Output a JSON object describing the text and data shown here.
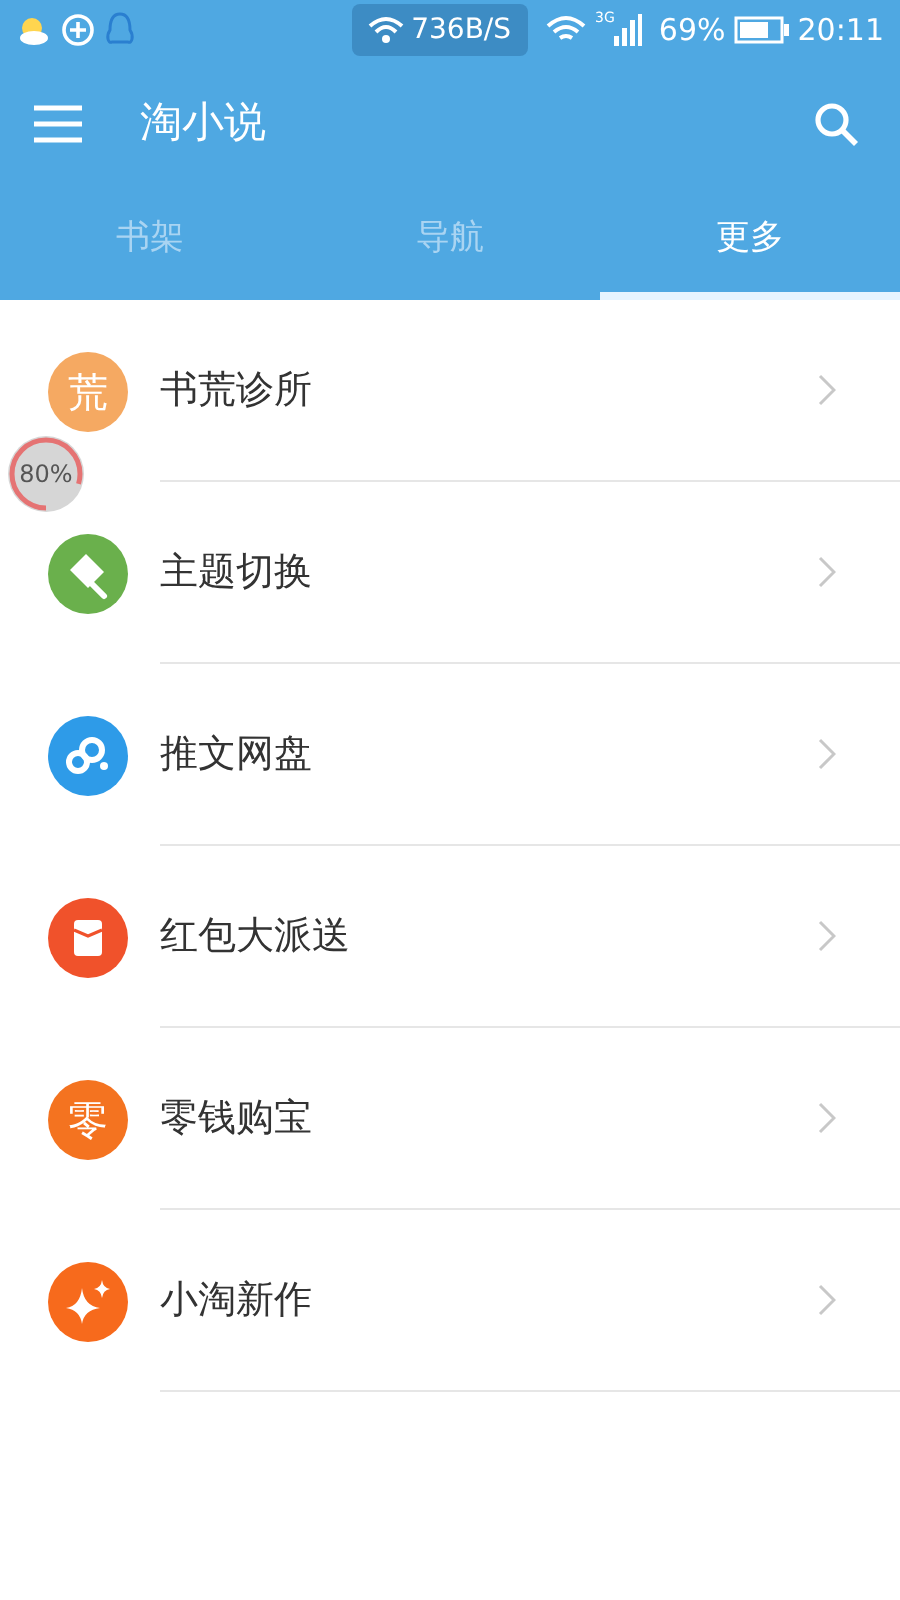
{
  "status_bar": {
    "speed": "736B/S",
    "network": "3G",
    "battery": "69%",
    "time": "20:11"
  },
  "toolbar": {
    "title": "淘小说"
  },
  "tabs": [
    {
      "label": "书架",
      "selected": false
    },
    {
      "label": "导航",
      "selected": false
    },
    {
      "label": "更多",
      "selected": true
    }
  ],
  "menu": [
    {
      "label": "书荒诊所",
      "kind": "glyph",
      "glyph": "荒",
      "color": "#f5a962"
    },
    {
      "label": "主题切换",
      "kind": "brush",
      "color": "#6ab04c"
    },
    {
      "label": "推文网盘",
      "kind": "cloud",
      "color": "#2e9be8"
    },
    {
      "label": "红包大派送",
      "kind": "envelope",
      "color": "#f0522b"
    },
    {
      "label": "零钱购宝",
      "kind": "glyph",
      "glyph": "零",
      "color": "#f47320"
    },
    {
      "label": "小淘新作",
      "kind": "sparkle",
      "color": "#f76a1c"
    }
  ],
  "floating_ball": {
    "text": "80%"
  }
}
